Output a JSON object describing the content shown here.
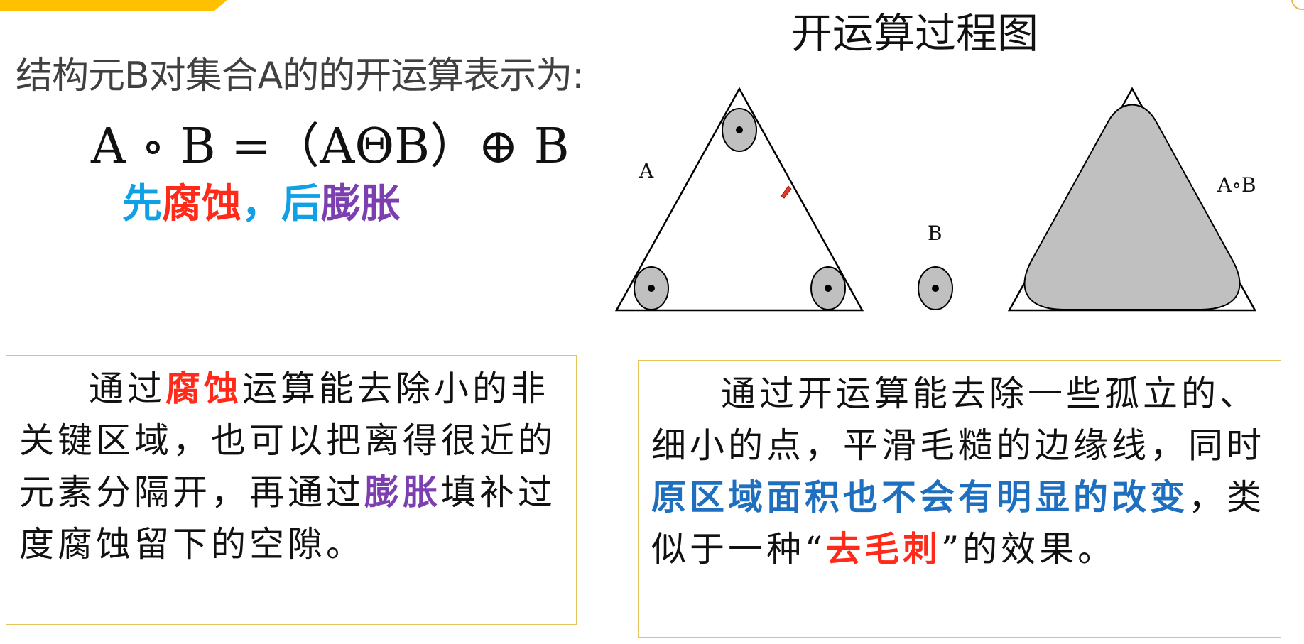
{
  "slide": {
    "intro_text": "结构元B对集合A的的开运算表示为:",
    "formula": "A ∘ B =（AΘB）⊕ B",
    "order": {
      "first": "先",
      "erode": "腐蚀",
      "comma": "，",
      "then": "后",
      "dilate": "膨胀"
    },
    "diagram": {
      "title": "开运算过程图",
      "label_a": "A",
      "label_b": "B",
      "label_result": "A∘B"
    },
    "left_box": {
      "t1": "通过",
      "t2": "腐蚀",
      "t3": "运算能去除小的非关键区域，也可以把离得很近的元素分隔开，再通过",
      "t4": "膨胀",
      "t5": "填补过度腐蚀留下的空隙。"
    },
    "right_box": {
      "t1": "通过开运算能去除一些孤立的、细小的点，平滑毛糙的边缘线，同时",
      "t2": "原区域面积也不会有明显的改变",
      "t3": "，类似于一种“",
      "t4": "去毛刺",
      "t5": "”的效果。"
    }
  },
  "colors": {
    "accent": "#ffc000",
    "first_blue": "#0fa0e6",
    "erode_red": "#ff2a1a",
    "dilate_purple": "#7c3fb0",
    "highlight_blue": "#1e6fc0",
    "box_border": "#e6c45a"
  }
}
